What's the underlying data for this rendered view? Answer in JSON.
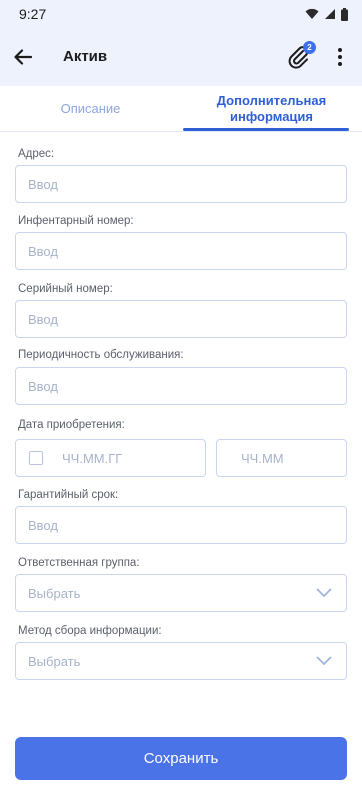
{
  "status_bar": {
    "time": "9:27"
  },
  "app_bar": {
    "title": "Актив",
    "attachment_count": "2"
  },
  "tabs": [
    {
      "label": "Описание"
    },
    {
      "label_line1": "Дополнительная",
      "label_line2": "информация"
    }
  ],
  "fields": {
    "address": {
      "label": "Адрес:",
      "placeholder": "Ввод"
    },
    "inventory": {
      "label": "Инфентарный номер:",
      "placeholder": "Ввод"
    },
    "serial": {
      "label": "Серийный номер:",
      "placeholder": "Ввод"
    },
    "maintenance": {
      "label": "Периодичность обслуживания:",
      "placeholder": "Ввод"
    },
    "purchase_date": {
      "label": "Дата приобретения:",
      "date_placeholder": "ЧЧ.ММ.ГГ",
      "time_placeholder": "ЧЧ.ММ"
    },
    "warranty": {
      "label": "Гарантийный срок:",
      "placeholder": "Ввод"
    },
    "responsible_group": {
      "label": "Ответственная группа:",
      "placeholder": "Выбрать"
    },
    "collection_method": {
      "label": "Метод сбора информации:",
      "placeholder": "Выбрать"
    }
  },
  "save_button": {
    "label": "Сохранить"
  },
  "colors": {
    "accent": "#2f5fd6",
    "button": "#4a73e8",
    "header_bg": "#eef2fc"
  }
}
